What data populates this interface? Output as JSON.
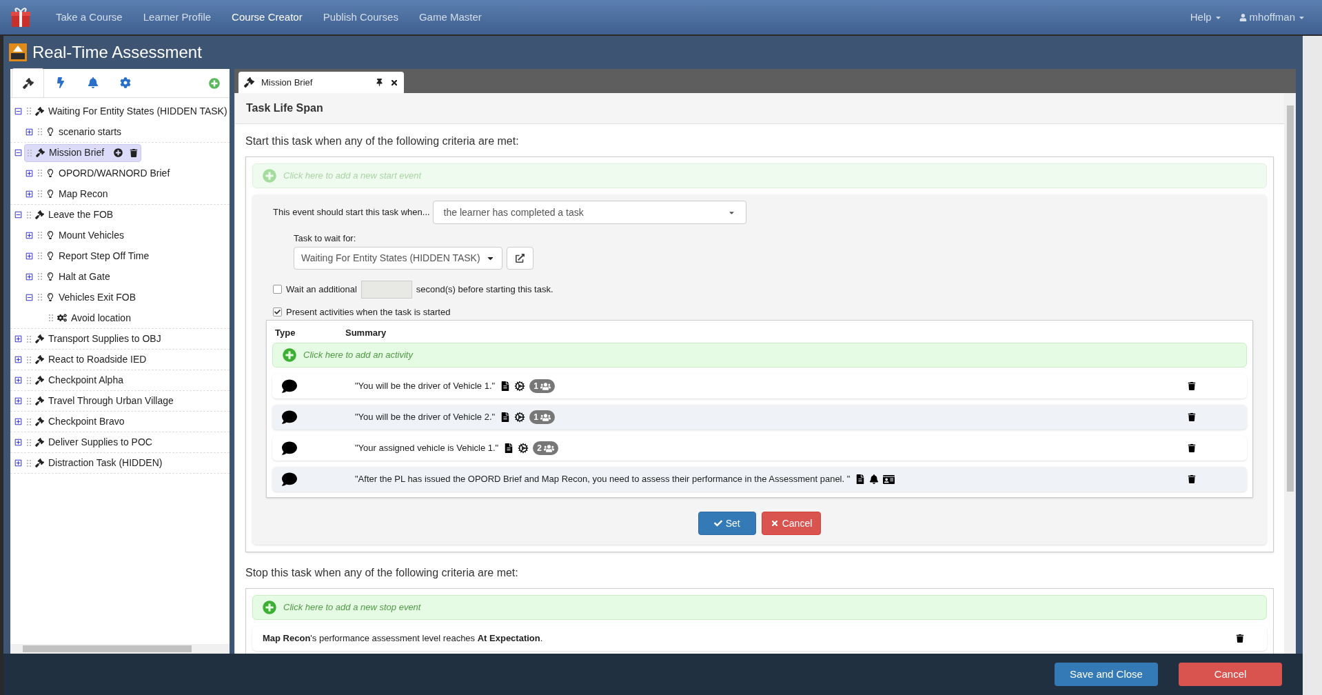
{
  "nav": {
    "items": [
      {
        "label": "Take a Course",
        "selected": false
      },
      {
        "label": "Learner Profile",
        "selected": false
      },
      {
        "label": "Course Creator",
        "selected": true
      },
      {
        "label": "Publish Courses",
        "selected": false
      },
      {
        "label": "Game Master",
        "selected": false
      }
    ],
    "help": "Help",
    "user": "mhoffman"
  },
  "modal": {
    "title": "Real-Time Assessment"
  },
  "sidebar": {
    "tabs": [
      {
        "kind": "tasks",
        "selected": true
      },
      {
        "kind": "triggers",
        "selected": false
      },
      {
        "kind": "notifications",
        "selected": false
      },
      {
        "kind": "settings",
        "selected": false
      }
    ],
    "tree": [
      {
        "label": "Waiting For Entity States (HIDDEN TASK)",
        "kind": "task",
        "expanded": true,
        "selected": false,
        "children": [
          {
            "label": "scenario starts",
            "kind": "condition",
            "expanded": false,
            "selected": false
          }
        ]
      },
      {
        "label": "Mission Brief",
        "kind": "task",
        "expanded": true,
        "selected": true,
        "children": [
          {
            "label": "OPORD/WARNORD Brief",
            "kind": "condition",
            "expanded": false,
            "selected": false
          },
          {
            "label": "Map Recon",
            "kind": "condition",
            "expanded": false,
            "selected": false
          }
        ]
      },
      {
        "label": "Leave the FOB",
        "kind": "task",
        "expanded": true,
        "selected": false,
        "children": [
          {
            "label": "Mount Vehicles",
            "kind": "condition",
            "expanded": false,
            "selected": false
          },
          {
            "label": "Report Step Off Time",
            "kind": "condition",
            "expanded": false,
            "selected": false
          },
          {
            "label": "Halt at Gate",
            "kind": "condition",
            "expanded": false,
            "selected": false
          },
          {
            "label": "Vehicles Exit FOB",
            "kind": "condition",
            "expanded": true,
            "selected": false,
            "children": [
              {
                "label": "Avoid location",
                "kind": "action",
                "selected": false
              }
            ]
          }
        ]
      },
      {
        "label": "Transport Supplies to OBJ",
        "kind": "task",
        "expanded": false,
        "selected": false
      },
      {
        "label": "React to Roadside IED",
        "kind": "task",
        "expanded": false,
        "selected": false
      },
      {
        "label": "Checkpoint Alpha",
        "kind": "task",
        "expanded": false,
        "selected": false
      },
      {
        "label": "Travel Through Urban Village",
        "kind": "task",
        "expanded": false,
        "selected": false
      },
      {
        "label": "Checkpoint Bravo",
        "kind": "task",
        "expanded": false,
        "selected": false
      },
      {
        "label": "Deliver Supplies to POC",
        "kind": "task",
        "expanded": false,
        "selected": false
      },
      {
        "label": "Distraction Task (HIDDEN)",
        "kind": "task",
        "expanded": false,
        "selected": false
      }
    ]
  },
  "doc_tab": {
    "label": "Mission Brief",
    "selected": true
  },
  "section": {
    "title": "Task Life Span",
    "start_heading": "Start this task when any of the following criteria are met:",
    "add_start_event": "Click here to add a new start event",
    "event": {
      "label": "This event should start this task when...",
      "condition": "the learner has completed a task",
      "task_label": "Task to wait for:",
      "task": "Waiting For Entity States (HIDDEN TASK)"
    },
    "wait": {
      "checked": false,
      "before": "Wait an additional",
      "after": "second(s) before starting this task."
    },
    "present": {
      "checked": true,
      "label": "Present activities when the task is started"
    },
    "activities": {
      "columns": [
        "Type",
        "Summary"
      ],
      "add": "Click here to add an activity",
      "rows": [
        {
          "kind": "dialog",
          "text": "\"You will be the driver of Vehicle 1.\"",
          "markers": [
            {
              "kind": "document"
            },
            {
              "kind": "cog"
            },
            {
              "kind": "group",
              "count": "1"
            }
          ]
        },
        {
          "kind": "dialog",
          "text": "\"You will be the driver of Vehicle 2.\"",
          "markers": [
            {
              "kind": "document"
            },
            {
              "kind": "cog"
            },
            {
              "kind": "group",
              "count": "1"
            }
          ]
        },
        {
          "kind": "dialog",
          "text": "\"Your assigned vehicle is Vehicle 1.\"",
          "markers": [
            {
              "kind": "document"
            },
            {
              "kind": "cog"
            },
            {
              "kind": "group",
              "count": "2"
            }
          ]
        },
        {
          "kind": "dialog",
          "text": "\"After the PL has issued the OPORD Brief and Map Recon, you need to assess their performance in the Assessment panel. \"",
          "markers": [
            {
              "kind": "document"
            },
            {
              "kind": "bell"
            },
            {
              "kind": "card"
            }
          ]
        }
      ]
    },
    "set": "Set",
    "cancel": "Cancel",
    "stop_heading": "Stop this task when any of the following criteria are met:",
    "add_stop_event": "Click here to add a new stop event",
    "stop_events": [
      {
        "text": "**Map Recon**'s performance assessment level reaches **At Expectation**."
      }
    ]
  },
  "footer": {
    "save": "Save and Close",
    "cancel": "Cancel"
  }
}
